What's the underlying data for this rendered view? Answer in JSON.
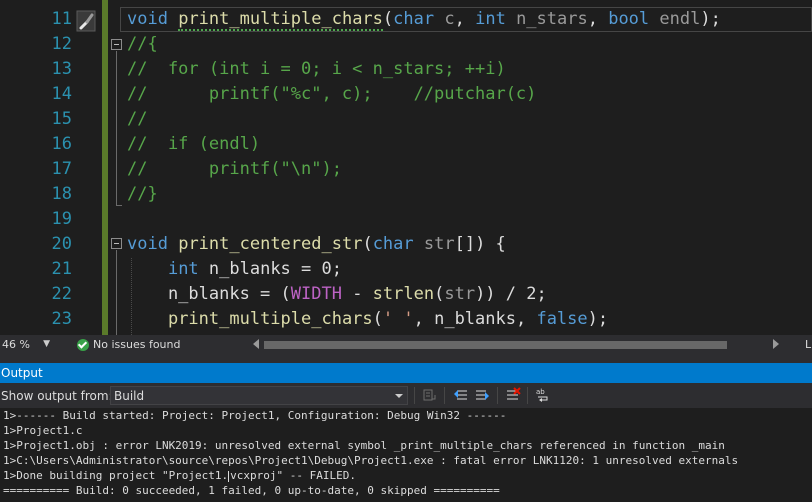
{
  "editor": {
    "line_numbers": [
      "11",
      "12",
      "13",
      "14",
      "15",
      "16",
      "17",
      "18",
      "19",
      "20",
      "21",
      "22",
      "23"
    ],
    "lines": [
      [
        {
          "t": "void",
          "c": "kw"
        },
        {
          "t": " "
        },
        {
          "t": "print_multiple_chars",
          "c": "fn"
        },
        {
          "t": "("
        },
        {
          "t": "char",
          "c": "kw"
        },
        {
          "t": " "
        },
        {
          "t": "c",
          "c": "pm"
        },
        {
          "t": ", "
        },
        {
          "t": "int",
          "c": "kw"
        },
        {
          "t": " "
        },
        {
          "t": "n_stars",
          "c": "pm"
        },
        {
          "t": ", "
        },
        {
          "t": "bool",
          "c": "kw"
        },
        {
          "t": " "
        },
        {
          "t": "endl",
          "c": "pm"
        },
        {
          "t": ");"
        }
      ],
      [
        {
          "t": "//{",
          "c": "cm"
        }
      ],
      [
        {
          "t": "//  for (int i = 0; i < n_stars; ++i)",
          "c": "cm"
        }
      ],
      [
        {
          "t": "//      printf(\"%c\", c);    //putchar(c)",
          "c": "cm"
        }
      ],
      [
        {
          "t": "//",
          "c": "cm"
        }
      ],
      [
        {
          "t": "//  if (endl)",
          "c": "cm"
        }
      ],
      [
        {
          "t": "//      printf(\"\\n\");",
          "c": "cm"
        }
      ],
      [
        {
          "t": "//}",
          "c": "cm"
        }
      ],
      [],
      [
        {
          "t": "void",
          "c": "kw"
        },
        {
          "t": " "
        },
        {
          "t": "print_centered_str",
          "c": "fn"
        },
        {
          "t": "("
        },
        {
          "t": "char",
          "c": "kw"
        },
        {
          "t": " "
        },
        {
          "t": "str",
          "c": "pm"
        },
        {
          "t": "[]) {"
        }
      ],
      [
        {
          "t": "    "
        },
        {
          "t": "int",
          "c": "kw"
        },
        {
          "t": " n_blanks = 0;"
        }
      ],
      [
        {
          "t": "    n_blanks = ("
        },
        {
          "t": "WIDTH",
          "c": "mac"
        },
        {
          "t": " - "
        },
        {
          "t": "strlen",
          "c": "fn"
        },
        {
          "t": "("
        },
        {
          "t": "str",
          "c": "pm"
        },
        {
          "t": ")) / 2;"
        }
      ],
      [
        {
          "t": "    "
        },
        {
          "t": "print_multiple_chars",
          "c": "fn"
        },
        {
          "t": "("
        },
        {
          "t": "' '",
          "c": "str"
        },
        {
          "t": ", n_blanks, "
        },
        {
          "t": "false",
          "c": "kw"
        },
        {
          "t": ");"
        }
      ]
    ]
  },
  "statusbar": {
    "zoom": "46 %",
    "issues": "No issues found",
    "extra": "L"
  },
  "output": {
    "title": "Output",
    "show_from_label": "Show output from:",
    "source": "Build",
    "lines": [
      "1>------ Build started: Project: Project1, Configuration: Debug Win32 ------",
      "1>Project1.c",
      "1>Project1.obj : error LNK2019: unresolved external symbol _print_multiple_chars referenced in function _main",
      "1>C:\\Users\\Administrator\\source\\repos\\Project1\\Debug\\Project1.exe : fatal error LNK1120: 1 unresolved externals",
      "1>Done building project \"Project1.vcxproj\" -- FAILED.",
      "========== Build: 0 succeeded, 1 failed, 0 up-to-date, 0 skipped =========="
    ]
  },
  "icons": {
    "quick_actions": "paintbrush-icon",
    "status_ok": "check-circle-icon",
    "toolbar": [
      "find-message-icon",
      "prev-message-icon",
      "next-message-icon",
      "clear-all-icon",
      "word-wrap-icon"
    ]
  },
  "colors": {
    "accent": "#007acc",
    "keyword": "#569cd6",
    "function": "#dcdcaa",
    "comment": "#57a64a",
    "macro": "#bd63c5",
    "line_number": "#2b91af"
  }
}
